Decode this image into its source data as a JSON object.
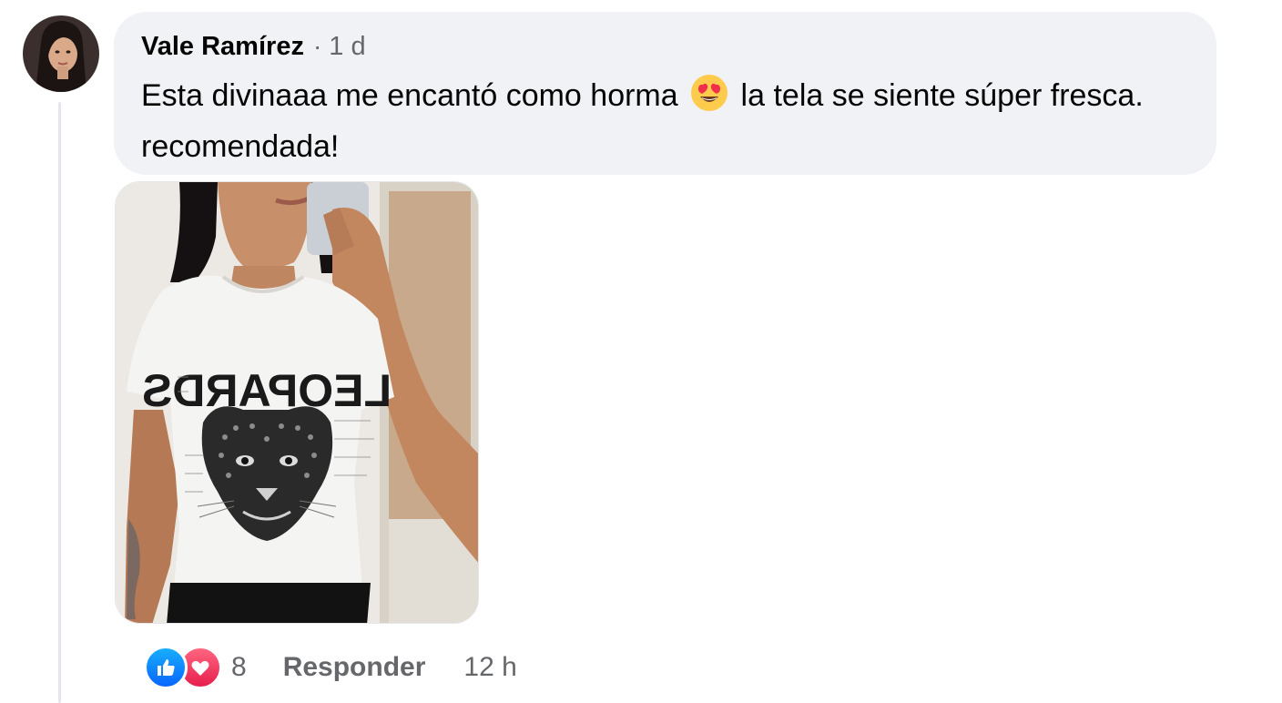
{
  "comment": {
    "author": "Vale Ramírez",
    "separator": "·",
    "time": "1 d",
    "text_part1": "Esta divinaaa me encantó como horma",
    "emoji": "heart-eyes-emoji",
    "text_part2": "la tela se siente súper fresca. recomendada!"
  },
  "photo": {
    "shirt_print": "LEOPARDS"
  },
  "actions": {
    "reaction_icons": [
      "like-icon",
      "love-icon"
    ],
    "reaction_count": "8",
    "reply_label": "Responder",
    "reply_time": "12 h"
  },
  "colors": {
    "bubble_bg": "#f0f2f5",
    "secondary_text": "#65676b",
    "like_blue": "#0866ff",
    "love_red": "#e61e4d"
  }
}
